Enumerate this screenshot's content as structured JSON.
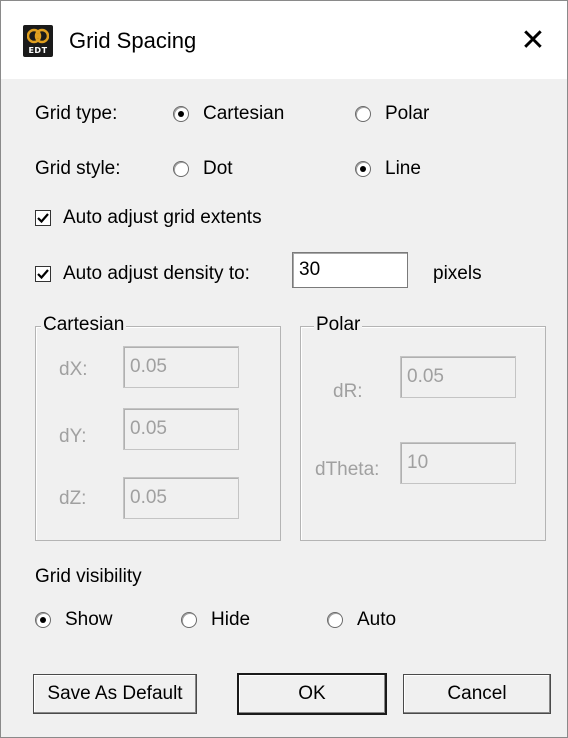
{
  "window": {
    "title": "Grid Spacing",
    "icon_name": "edt-app-icon",
    "icon_text": "EDT",
    "close_glyph": "✕"
  },
  "grid_type": {
    "label": "Grid type:",
    "options": [
      {
        "label": "Cartesian",
        "selected": true
      },
      {
        "label": "Polar",
        "selected": false
      }
    ]
  },
  "grid_style": {
    "label": "Grid style:",
    "options": [
      {
        "label": "Dot",
        "selected": false
      },
      {
        "label": "Line",
        "selected": true
      }
    ]
  },
  "auto_extents": {
    "label": "Auto adjust grid extents",
    "checked": true
  },
  "auto_density": {
    "label": "Auto adjust density to:",
    "checked": true,
    "value": "30",
    "unit": "pixels"
  },
  "cartesian": {
    "title": "Cartesian",
    "fields": [
      {
        "label": "dX:",
        "value": "0.05"
      },
      {
        "label": "dY:",
        "value": "0.05"
      },
      {
        "label": "dZ:",
        "value": "0.05"
      }
    ]
  },
  "polar": {
    "title": "Polar",
    "fields": [
      {
        "label": "dR:",
        "value": "0.05"
      },
      {
        "label": "dTheta:",
        "value": "10"
      }
    ]
  },
  "visibility": {
    "label": "Grid visibility",
    "options": [
      {
        "label": "Show",
        "selected": true
      },
      {
        "label": "Hide",
        "selected": false
      },
      {
        "label": "Auto",
        "selected": false
      }
    ]
  },
  "buttons": {
    "save_default": "Save As Default",
    "ok": "OK",
    "cancel": "Cancel"
  }
}
